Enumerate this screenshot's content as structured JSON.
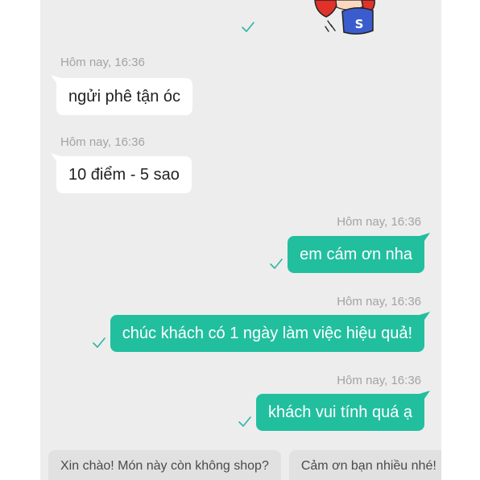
{
  "colors": {
    "panel_bg": "#ededed",
    "bubble_incoming": "#ffffff",
    "bubble_outgoing": "#22bf9f",
    "check": "#2db7a3",
    "timestamp": "#a3a3a3",
    "chip_bg": "#e1e1e1",
    "chip_text": "#4a4a4a"
  },
  "sticker_message": {
    "outgoing": true,
    "letter": "S",
    "status_icon": "check-icon"
  },
  "messages": [
    {
      "outgoing": false,
      "time": "Hôm nay, 16:36",
      "text": "ngửi phê tận óc"
    },
    {
      "outgoing": false,
      "time": "Hôm nay, 16:36",
      "text": "10 điểm - 5 sao"
    },
    {
      "outgoing": true,
      "time": "Hôm nay, 16:36",
      "text": "em cám ơn nha",
      "status_icon": "check-icon"
    },
    {
      "outgoing": true,
      "time": "Hôm nay, 16:36",
      "text": "chúc khách có 1 ngày làm việc hiệu quả!",
      "status_icon": "check-icon"
    },
    {
      "outgoing": true,
      "time": "Hôm nay, 16:36",
      "text": "khách vui tính quá ạ",
      "status_icon": "check-icon"
    }
  ],
  "quick_replies": [
    {
      "label": "Xin chào! Món này còn không shop?"
    },
    {
      "label": "Cảm ơn bạn nhiều nhé!"
    }
  ]
}
